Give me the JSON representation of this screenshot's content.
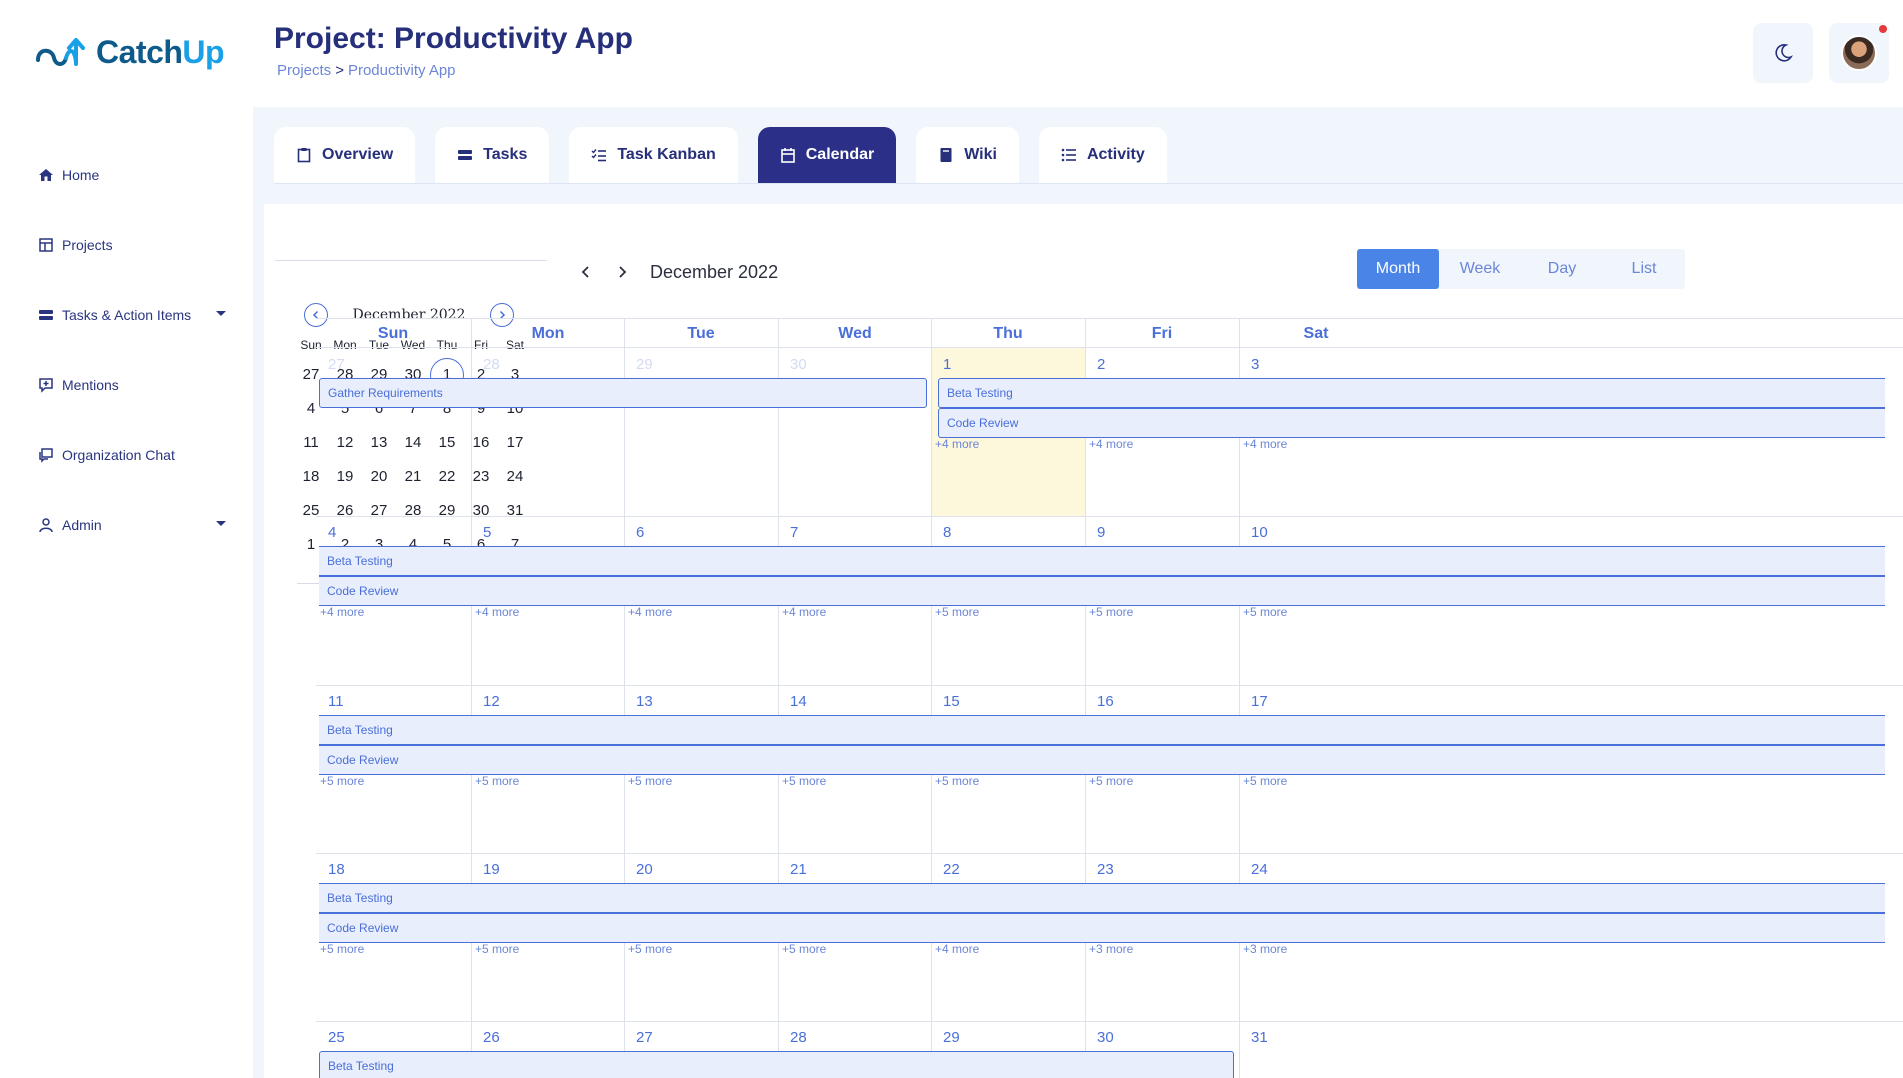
{
  "brand": {
    "name_part1": "Catch",
    "name_part2": "Up",
    "accent": "#1aa0e6",
    "primary": "#2b2f88"
  },
  "header": {
    "title": "Project: Productivity App",
    "breadcrumb": {
      "root": "Projects",
      "separator": ">",
      "current": "Productivity App"
    },
    "theme_toggle_icon": "moon-icon",
    "avatar_icon": "user-avatar"
  },
  "sidebar": {
    "items": [
      {
        "label": "Home",
        "icon": "home-icon"
      },
      {
        "label": "Projects",
        "icon": "projects-icon"
      },
      {
        "label": "Tasks & Action Items",
        "icon": "tasks-icon",
        "has_caret": true
      },
      {
        "label": "Mentions",
        "icon": "mention-icon"
      },
      {
        "label": "Organization Chat",
        "icon": "chat-icon"
      },
      {
        "label": "Admin",
        "icon": "user-icon",
        "has_caret": true
      }
    ]
  },
  "tabs": [
    {
      "label": "Overview",
      "icon": "clipboard-icon"
    },
    {
      "label": "Tasks",
      "icon": "list-icon"
    },
    {
      "label": "Task Kanban",
      "icon": "checklist-icon"
    },
    {
      "label": "Calendar",
      "icon": "calendar-icon",
      "active": true
    },
    {
      "label": "Wiki",
      "icon": "book-icon"
    },
    {
      "label": "Activity",
      "icon": "activity-list-icon"
    }
  ],
  "mini_calendar": {
    "month": "December 2022",
    "dow": [
      "Sun",
      "Mon",
      "Tue",
      "Wed",
      "Thu",
      "Fri",
      "Sat"
    ],
    "weeks": [
      [
        "27",
        "28",
        "29",
        "30",
        "1",
        "2",
        "3"
      ],
      [
        "4",
        "5",
        "6",
        "7",
        "8",
        "9",
        "10"
      ],
      [
        "11",
        "12",
        "13",
        "14",
        "15",
        "16",
        "17"
      ],
      [
        "18",
        "19",
        "20",
        "21",
        "22",
        "23",
        "24"
      ],
      [
        "25",
        "26",
        "27",
        "28",
        "29",
        "30",
        "31"
      ],
      [
        "1",
        "2",
        "3",
        "4",
        "5",
        "6",
        "7"
      ]
    ],
    "today": "1"
  },
  "calendar": {
    "title": "December 2022",
    "views": [
      "Month",
      "Week",
      "Day",
      "List"
    ],
    "active_view": "Month",
    "dow": [
      "Sun",
      "Mon",
      "Tue",
      "Wed",
      "Thu",
      "Fri",
      "Sat"
    ],
    "weeks": [
      {
        "days": [
          "27",
          "28",
          "29",
          "30",
          "1",
          "2",
          "3"
        ],
        "other_month": [
          true,
          true,
          true,
          true,
          false,
          false,
          false
        ],
        "today_index": 4,
        "events": [
          {
            "title": "Gather Requirements",
            "start": 0,
            "end": 3,
            "row": 0,
            "ends_here": true
          },
          {
            "title": "Beta Testing",
            "start": 4,
            "end": 6,
            "row": 0,
            "starts_here": true
          },
          {
            "title": "Code Review",
            "start": 4,
            "end": 6,
            "row": 1,
            "starts_here": true
          }
        ],
        "more": [
          "",
          "",
          "",
          "",
          "+4 more",
          "+4 more",
          "+4 more"
        ]
      },
      {
        "days": [
          "4",
          "5",
          "6",
          "7",
          "8",
          "9",
          "10"
        ],
        "events": [
          {
            "title": "Beta Testing",
            "start": 0,
            "end": 6,
            "row": 0
          },
          {
            "title": "Code Review",
            "start": 0,
            "end": 6,
            "row": 1
          }
        ],
        "more": [
          "+4 more",
          "+4 more",
          "+4 more",
          "+4 more",
          "+5 more",
          "+5 more",
          "+5 more"
        ]
      },
      {
        "days": [
          "11",
          "12",
          "13",
          "14",
          "15",
          "16",
          "17"
        ],
        "events": [
          {
            "title": "Beta Testing",
            "start": 0,
            "end": 6,
            "row": 0
          },
          {
            "title": "Code Review",
            "start": 0,
            "end": 6,
            "row": 1
          }
        ],
        "more": [
          "+5 more",
          "+5 more",
          "+5 more",
          "+5 more",
          "+5 more",
          "+5 more",
          "+5 more"
        ]
      },
      {
        "days": [
          "18",
          "19",
          "20",
          "21",
          "22",
          "23",
          "24"
        ],
        "events": [
          {
            "title": "Beta Testing",
            "start": 0,
            "end": 6,
            "row": 0
          },
          {
            "title": "Code Review",
            "start": 0,
            "end": 6,
            "row": 1
          }
        ],
        "more": [
          "+5 more",
          "+5 more",
          "+5 more",
          "+5 more",
          "+4 more",
          "+3 more",
          "+3 more"
        ]
      },
      {
        "days": [
          "25",
          "26",
          "27",
          "28",
          "29",
          "30",
          "31"
        ],
        "events": [
          {
            "title": "Beta Testing",
            "start": 0,
            "end": 5,
            "row": 0,
            "ends_here": true
          }
        ],
        "more": [
          "",
          "",
          "",
          "",
          "",
          "",
          ""
        ]
      }
    ]
  }
}
